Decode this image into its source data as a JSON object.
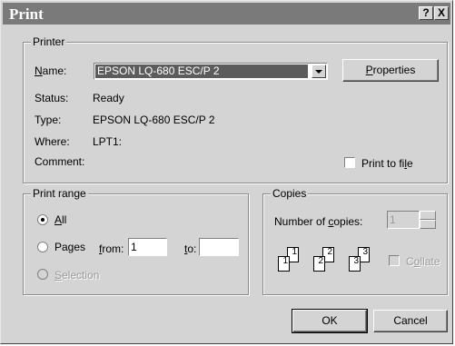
{
  "window": {
    "title": "Print",
    "help_btn": "?",
    "close_btn": "X"
  },
  "printer": {
    "group_label": "Printer",
    "name_label": "Name:",
    "name_value": "EPSON LQ-680 ESC/P 2",
    "properties_label": "Properties",
    "status_label": "Status:",
    "status_value": "Ready",
    "type_label": "Type:",
    "type_value": "EPSON LQ-680 ESC/P 2",
    "where_label": "Where:",
    "where_value": "LPT1:",
    "comment_label": "Comment:",
    "print_to_file_label": "Print to file"
  },
  "print_range": {
    "group_label": "Print range",
    "all_label": "All",
    "pages_label": "Pages",
    "from_label": "from:",
    "from_value": "1",
    "to_label": "to:",
    "to_value": "",
    "selection_label": "Selection"
  },
  "copies": {
    "group_label": "Copies",
    "number_label": "Number of copies:",
    "number_value": "1",
    "collate_label": "Collate",
    "collate_icon": "collate-pages-icon",
    "page_numbers": [
      "1",
      "1",
      "2",
      "2",
      "3",
      "3"
    ]
  },
  "footer": {
    "ok_label": "OK",
    "cancel_label": "Cancel"
  }
}
